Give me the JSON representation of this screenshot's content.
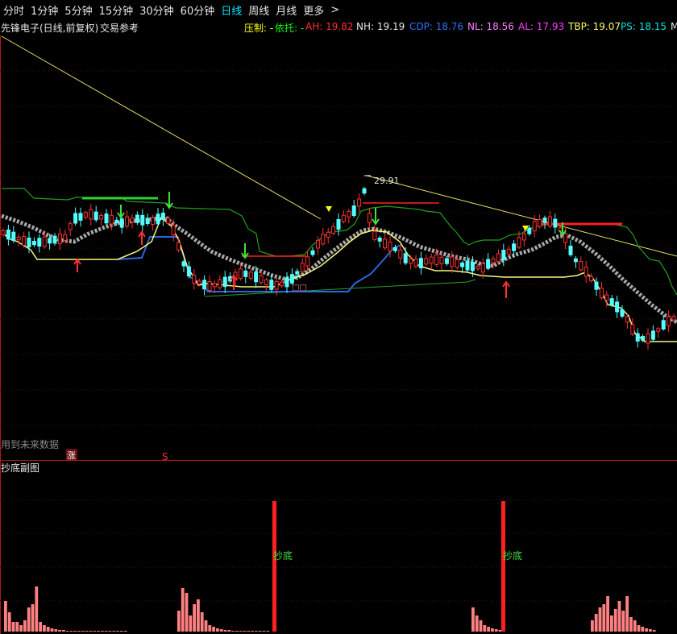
{
  "toolbar": {
    "periods": [
      "分时",
      "1分钟",
      "5分钟",
      "15分钟",
      "30分钟",
      "60分钟",
      "日线",
      "周线",
      "月线",
      "更多"
    ],
    "active_index": 6,
    "more_arrow": ">"
  },
  "header": {
    "stock_name": "先锋电子(日线,前复权)",
    "indicator_name": "交易参考",
    "pressure_label": "压制: -",
    "support_label": "依托: -",
    "ah": "AH: 19.82",
    "nh": "NH: 19.19",
    "cdp": "CDP: 18.76",
    "nl": "NL: 18.56",
    "al": "AL: 17.93",
    "tbp": "TBP: 19.07",
    "ps": "PS: 18.15",
    "overflow": "M"
  },
  "main_chart": {
    "peak_label": "29.91",
    "future_data_label": "用到未来数据",
    "zhang_badge": "涨",
    "s_marker": "S",
    "box_marker": "□□"
  },
  "sub_chart": {
    "title": "抄底副图",
    "signal_label": "抄底"
  },
  "colors": {
    "active_period": "#00e5ff",
    "pressure": "#ffff00",
    "support": "#00ff00",
    "ah": "#ff3030",
    "cdp": "#3070ff",
    "nl": "#ff80ff",
    "al": "#ff40ff",
    "tbp": "#ffff60",
    "ps": "#00e5e5",
    "up_candle": "#ff3030",
    "down_candle": "#54ffff",
    "signal_bar": "#ff2020",
    "histogram": "#ff8080"
  }
}
